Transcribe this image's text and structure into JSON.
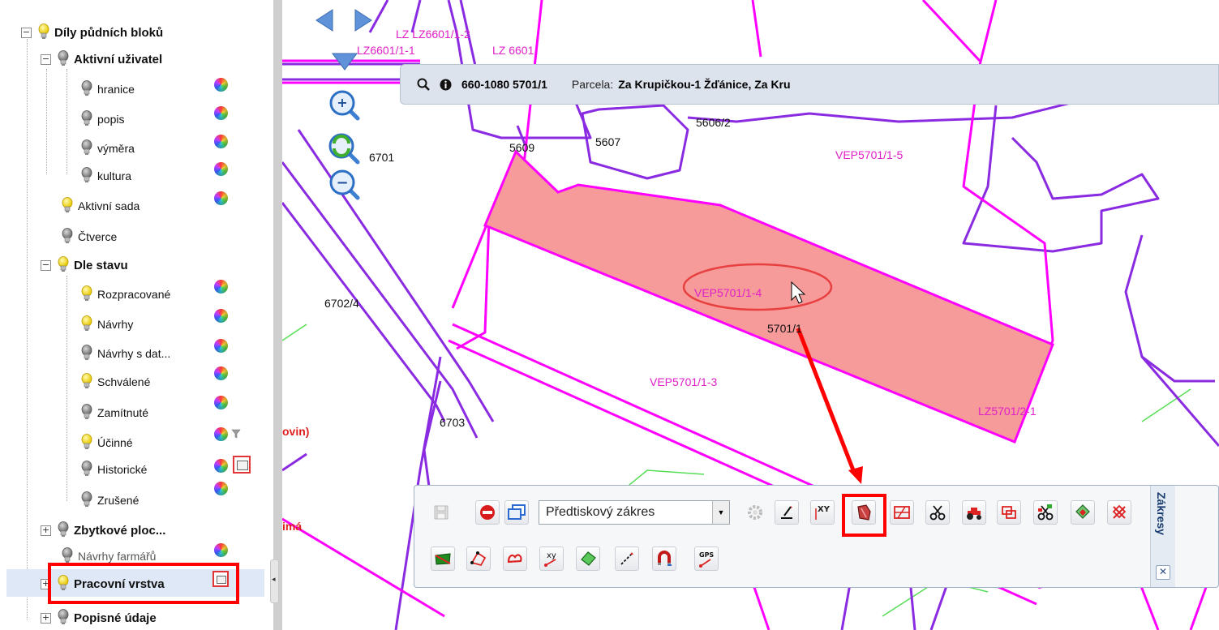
{
  "layer_tree": {
    "root": {
      "label": "Díly půdních bloků"
    },
    "groups": [
      {
        "label": "Aktivní uživatel"
      },
      {
        "label": "Dle stavu"
      },
      {
        "label": "Zbytkové ploc..."
      },
      {
        "label": "Pracovní vrstva"
      },
      {
        "label": "Popisné údaje"
      }
    ],
    "items": [
      {
        "label": "hranice"
      },
      {
        "label": "popis"
      },
      {
        "label": "výměra"
      },
      {
        "label": "kultura"
      },
      {
        "label": "Aktivní sada"
      },
      {
        "label": "Čtverce"
      },
      {
        "label": "Rozpracované"
      },
      {
        "label": "Návrhy"
      },
      {
        "label": "Návrhy s dat..."
      },
      {
        "label": "Schválené"
      },
      {
        "label": "Zamítnuté"
      },
      {
        "label": "Účinné"
      },
      {
        "label": "Historické"
      },
      {
        "label": "Zrušené"
      },
      {
        "label": "Návrhy farmářů"
      }
    ]
  },
  "infobar": {
    "code": "660-1080 5701/1",
    "parcel_label": "Parcela:",
    "parcel_value": "Za Krupičkou-1 Žďánice, Za Kru"
  },
  "toolbar": {
    "select_value": "Předtiskový zákres",
    "panel_title": "Zákresy",
    "close_label": "✕"
  },
  "map_labels": {
    "l1": "LZ LZ6601/1-2",
    "l2": "LZ6601/1-1",
    "l3": "LZ 6601",
    "l4": "5606/2",
    "l5": "5607",
    "l6": "5609",
    "l7": "6701",
    "l8": "VEP5701/1-5",
    "l9": "VEP5701/1-4",
    "l10": "5701/1",
    "l11": "6702/4",
    "l12": "VEP5701/1-3",
    "l13": "6703",
    "l14": "LZ5701/2-1",
    "l15": "ovin)",
    "l16": "imá"
  },
  "colors": {
    "parcel_fill": "#f79a9a",
    "magenta": "#ff00ff",
    "purple": "#8a2be2",
    "green": "#55dd55",
    "highlight": "#ff0000"
  }
}
